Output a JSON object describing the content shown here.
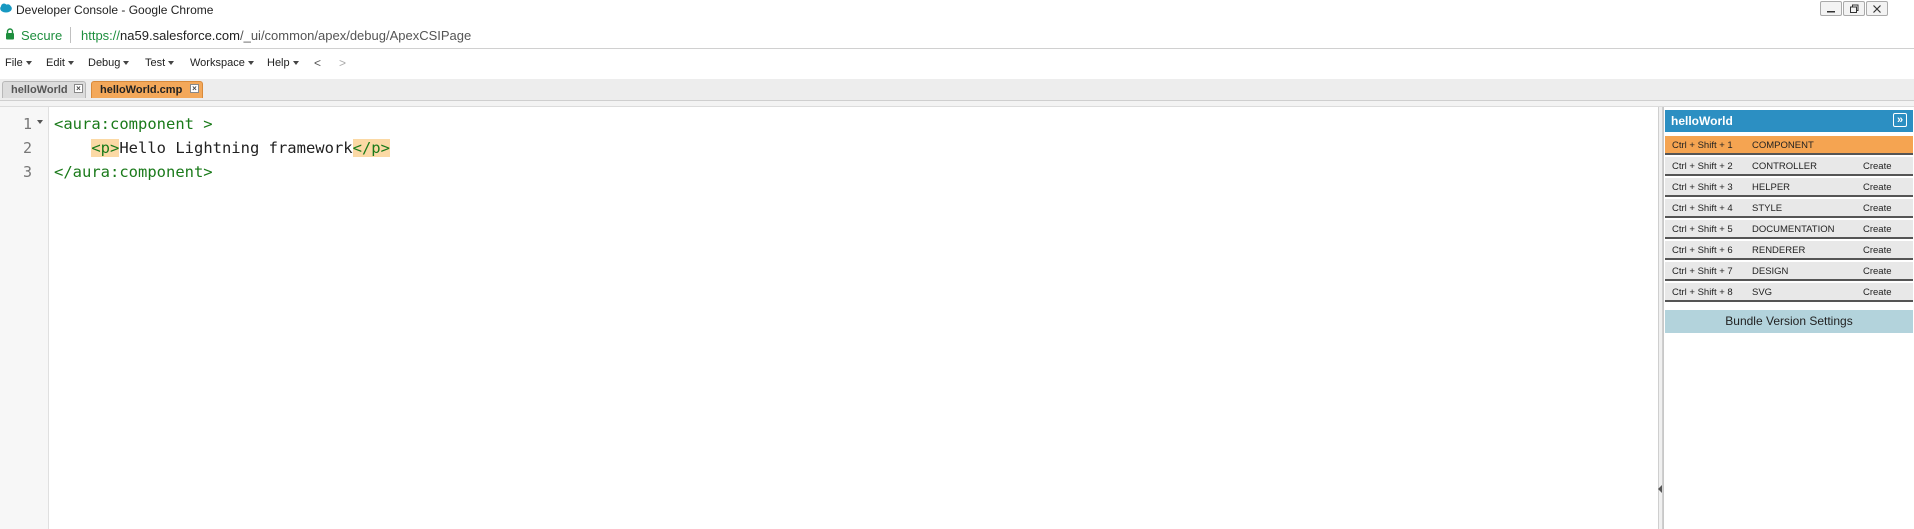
{
  "window": {
    "title": "Developer Console - Google Chrome"
  },
  "address_bar": {
    "secure_label": "Secure",
    "url_protocol": "https://",
    "url_host": "na59.salesforce.com",
    "url_path": "/_ui/common/apex/debug/ApexCSIPage"
  },
  "menu": {
    "items": [
      "File",
      "Edit",
      "Debug",
      "Test",
      "Workspace",
      "Help"
    ],
    "back": "<",
    "forward": ">"
  },
  "tabs": [
    {
      "label": "helloWorld",
      "active": false
    },
    {
      "label": "helloWorld.cmp",
      "active": true
    }
  ],
  "editor": {
    "line_numbers": [
      "1",
      "2",
      "3"
    ],
    "lines": {
      "l1": "<aura:component >",
      "l2_open": "<p>",
      "l2_text": "Hello Lightning framework",
      "l2_close": "</p>",
      "l3": "</aura:component>"
    }
  },
  "bundle_panel": {
    "title": "helloWorld",
    "toggle_icon": "double-chevron-right-icon",
    "rows": [
      {
        "shortcut": "Ctrl + Shift + 1",
        "name": "COMPONENT",
        "action": ""
      },
      {
        "shortcut": "Ctrl + Shift + 2",
        "name": "CONTROLLER",
        "action": "Create"
      },
      {
        "shortcut": "Ctrl + Shift + 3",
        "name": "HELPER",
        "action": "Create"
      },
      {
        "shortcut": "Ctrl + Shift + 4",
        "name": "STYLE",
        "action": "Create"
      },
      {
        "shortcut": "Ctrl + Shift + 5",
        "name": "DOCUMENTATION",
        "action": "Create"
      },
      {
        "shortcut": "Ctrl + Shift + 6",
        "name": "RENDERER",
        "action": "Create"
      },
      {
        "shortcut": "Ctrl + Shift + 7",
        "name": "DESIGN",
        "action": "Create"
      },
      {
        "shortcut": "Ctrl + Shift + 8",
        "name": "SVG",
        "action": "Create"
      }
    ],
    "settings_label": "Bundle Version Settings"
  },
  "colors": {
    "accent_blue": "#2c8fc2",
    "active_orange": "#f5a451",
    "code_green": "#1a7a1a",
    "secure_green": "#1e8e3e",
    "settings_bg": "#b3d3dc"
  }
}
